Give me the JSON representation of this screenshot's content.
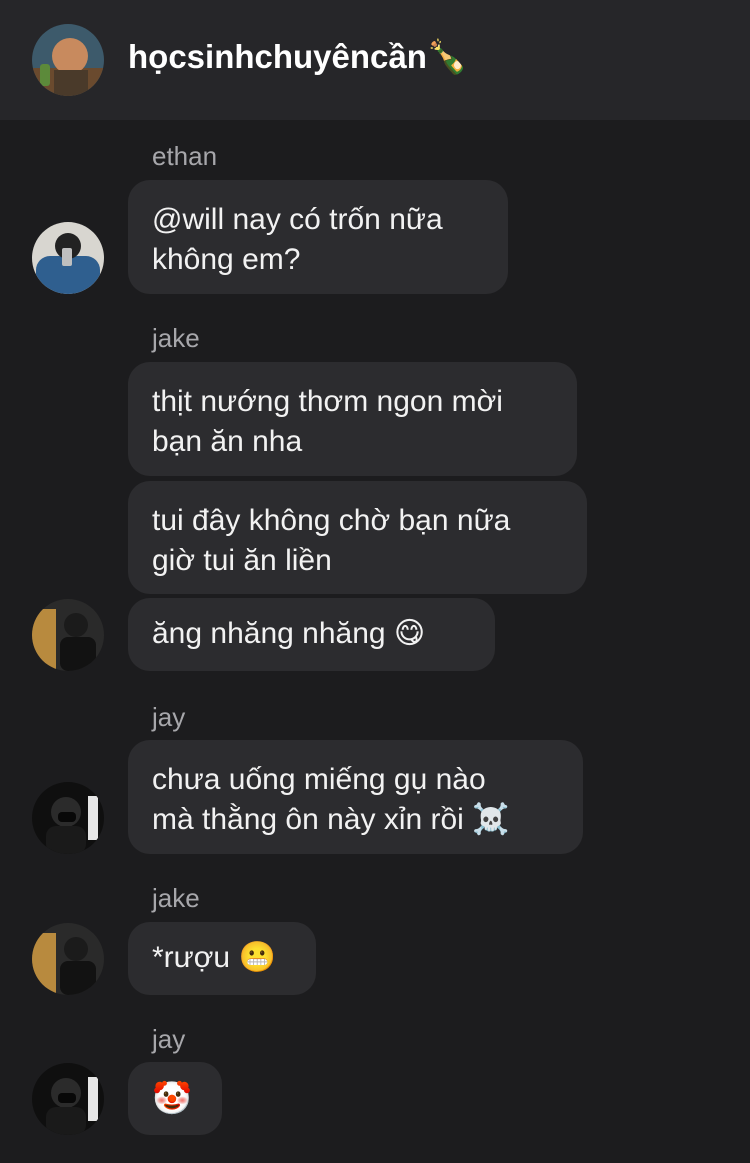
{
  "header": {
    "title": "họcsinhchuyêncần🍾",
    "avatar": "group-avatar"
  },
  "messages": [
    {
      "sender": "ethan",
      "lines": [
        "@will nay có trốn nữa",
        "không em?"
      ],
      "avatar": "ethan-avatar"
    },
    {
      "sender": "jake",
      "lines": [
        "thịt nướng thơm ngon mời",
        "bạn ăn nha"
      ]
    },
    {
      "lines": [
        "tui đây không chờ bạn nữa",
        "giờ tui ăn liền"
      ]
    },
    {
      "lines": [
        "ăng nhăng nhăng 😋"
      ],
      "avatar": "jake-avatar"
    },
    {
      "sender": "jay",
      "lines": [
        "chưa uống miếng gụ nào",
        "mà thằng ôn này xỉn rồi ☠️"
      ],
      "avatar": "jay-avatar"
    },
    {
      "sender": "jake",
      "lines": [
        "*rượu 😬"
      ],
      "avatar": "jake-avatar"
    },
    {
      "sender": "jay",
      "lines": [
        "🤡"
      ],
      "avatar": "jay-avatar"
    }
  ],
  "colors": {
    "background": "#1c1c1e",
    "header": "#262629",
    "bubble": "#2c2c2f",
    "sender_name": "#a7a7ab"
  }
}
